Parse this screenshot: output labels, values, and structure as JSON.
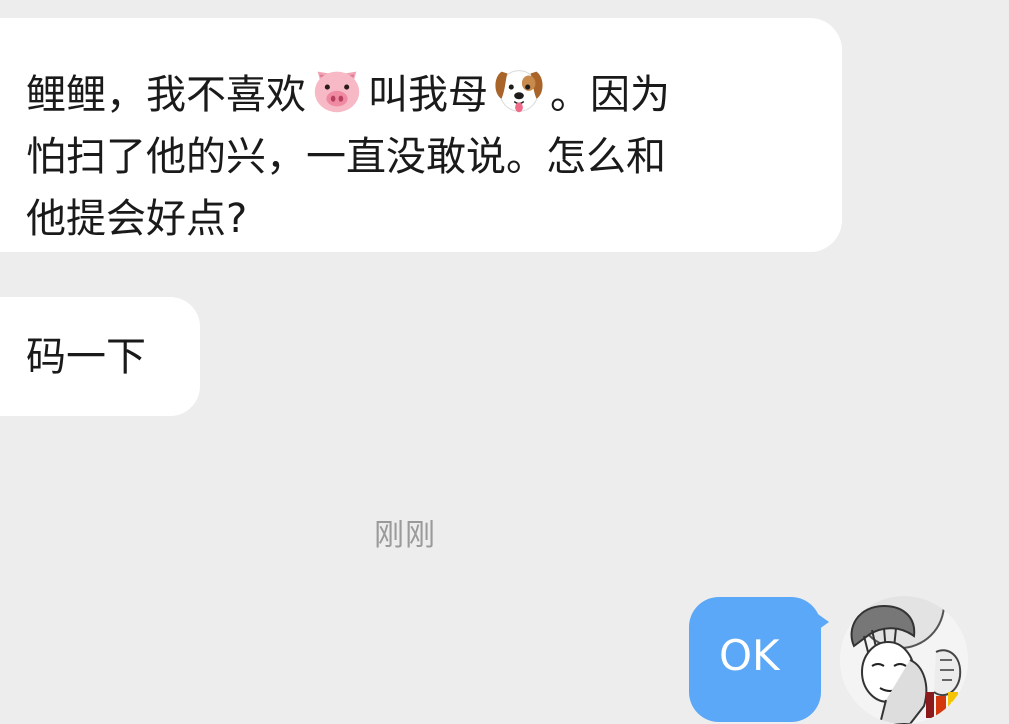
{
  "messages": [
    {
      "id": "incoming-1",
      "direction": "incoming",
      "lines": [
        {
          "before": "鲤鲤，我不喜欢",
          "emoji1": "pig-face-emoji",
          "middle": "叫我母",
          "emoji2": "dog-face-emoji",
          "after": "。因为"
        },
        {
          "text": "怕扫了他的兴，一直没敢说。怎么和"
        },
        {
          "text": "他提会好点?"
        }
      ]
    },
    {
      "id": "incoming-2",
      "direction": "incoming",
      "text": "码一下"
    },
    {
      "id": "outgoing-1",
      "direction": "outgoing",
      "text": "OK"
    }
  ],
  "timestamp": "刚刚",
  "avatar": {
    "icon": "manga-character-avatar"
  },
  "colors": {
    "background": "#ededed",
    "incoming_bubble": "#ffffff",
    "outgoing_bubble": "#5aa8f7",
    "timestamp_text": "#9a9a9a"
  }
}
